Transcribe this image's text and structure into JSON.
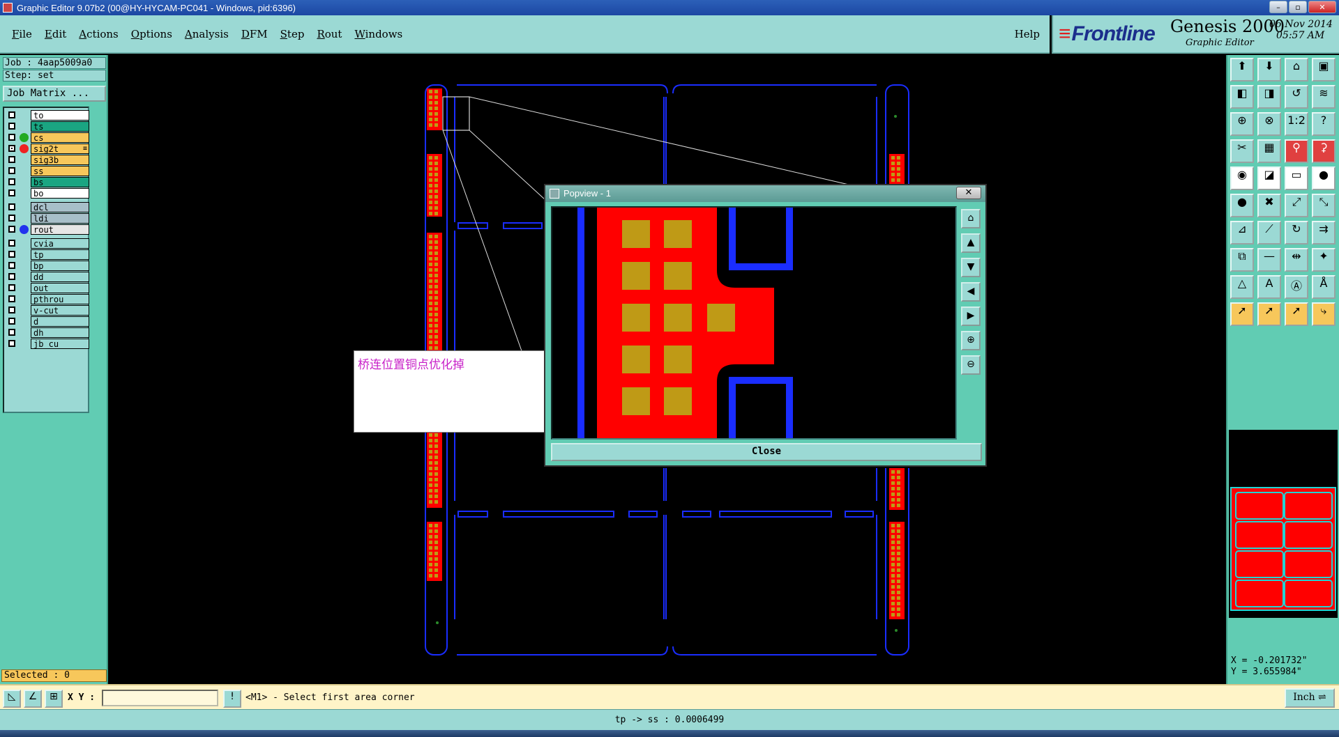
{
  "window": {
    "title": "Graphic Editor 9.07b2 (00@HY-HYCAM-PC041 - Windows, pid:6396)",
    "controls": [
      "–",
      "▫",
      "✕"
    ]
  },
  "menu": {
    "items": [
      "File",
      "Edit",
      "Actions",
      "Options",
      "Analysis",
      "DFM",
      "Step",
      "Rout",
      "Windows"
    ],
    "help": "Help"
  },
  "brand": {
    "logo": "Frontline",
    "product": "Genesis 2000",
    "subtitle": "Graphic Editor",
    "date": "06 Nov 2014",
    "time": "05:57 AM"
  },
  "job": {
    "job_line": "Job : 4aap5009a0",
    "step_line": "Step: set",
    "job_matrix_label": "Job Matrix ..."
  },
  "layers": [
    {
      "name": "to",
      "color": "#ffffff",
      "checked": false,
      "dot": ""
    },
    {
      "name": "ts",
      "color": "#1aa582",
      "checked": false,
      "dot": ""
    },
    {
      "name": "cs",
      "color": "#f7c75b",
      "checked": false,
      "dot": "#22aa22"
    },
    {
      "name": "sig2t",
      "color": "#f7c75b",
      "checked": true,
      "dot": "#ee2222",
      "mark": "≡"
    },
    {
      "name": "sig3b",
      "color": "#f7c75b",
      "checked": false,
      "dot": ""
    },
    {
      "name": "ss",
      "color": "#f7c75b",
      "checked": false,
      "dot": ""
    },
    {
      "name": "bs",
      "color": "#1aa582",
      "checked": false,
      "dot": ""
    },
    {
      "name": "bo",
      "color": "#ffffff",
      "checked": false,
      "dot": ""
    },
    {
      "name": "dcl",
      "color": "#a7bfc9",
      "checked": false,
      "dot": ""
    },
    {
      "name": "ldi",
      "color": "#a7bfc9",
      "checked": false,
      "dot": ""
    },
    {
      "name": "rout",
      "color": "#e6e6e6",
      "checked": false,
      "dot": "#2233ee"
    },
    {
      "name": "cvia",
      "color": "#9bd9d4",
      "checked": false,
      "dot": ""
    },
    {
      "name": "tp",
      "color": "#9bd9d4",
      "checked": false,
      "dot": ""
    },
    {
      "name": "bp",
      "color": "#9bd9d4",
      "checked": false,
      "dot": ""
    },
    {
      "name": "dd",
      "color": "#9bd9d4",
      "checked": false,
      "dot": ""
    },
    {
      "name": "out",
      "color": "#9bd9d4",
      "checked": false,
      "dot": ""
    },
    {
      "name": "pthrou",
      "color": "#9bd9d4",
      "checked": false,
      "dot": ""
    },
    {
      "name": "v-cut",
      "color": "#9bd9d4",
      "checked": false,
      "dot": ""
    },
    {
      "name": "d",
      "color": "#9bd9d4",
      "checked": false,
      "dot": ""
    },
    {
      "name": "dh",
      "color": "#9bd9d4",
      "checked": false,
      "dot": ""
    },
    {
      "name": "jb_cu",
      "color": "#9bd9d4",
      "checked": false,
      "dot": ""
    }
  ],
  "selected": "Selected : 0",
  "note": {
    "text": "桥连位置铜点优化掉"
  },
  "popview": {
    "title": "Popview - 1",
    "close_x": "✕",
    "close_label": "Close"
  },
  "coords": {
    "x": "X = -0.201732\"",
    "y": "Y = 3.655984\""
  },
  "command": {
    "xy_label": "X Y :",
    "xy_value": "",
    "prompt": "<M1> - Select first area corner",
    "unit": "Inch ⇌"
  },
  "status": "tp -> ss : 0.0006499",
  "colors": {
    "panel": "#9bd9d4",
    "panel_dark": "#61ccb3",
    "copper": "#ff0000",
    "pad": "#bf9a16",
    "rout": "#1a2dff"
  }
}
